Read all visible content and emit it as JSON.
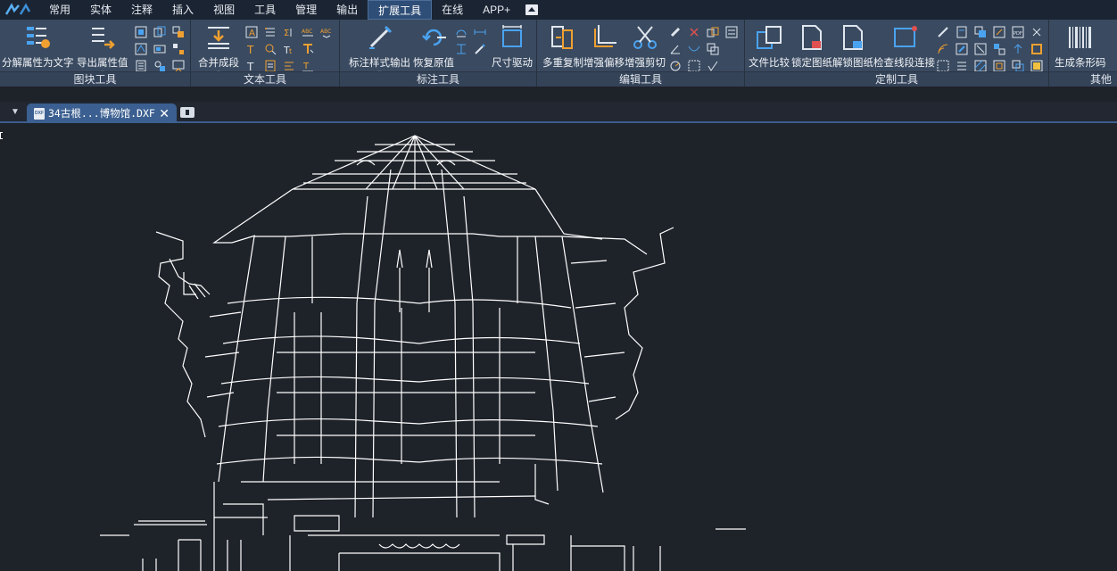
{
  "menu": {
    "items": [
      "常用",
      "实体",
      "注释",
      "插入",
      "视图",
      "工具",
      "管理",
      "输出",
      "扩展工具",
      "在线",
      "APP+"
    ],
    "active_index": 8
  },
  "ribbon": {
    "groups": {
      "block_tools": {
        "label": "图块工具",
        "explode_to_text": "分解属性为文字",
        "export_attr": "导出属性值"
      },
      "text_tools": {
        "label": "文本工具",
        "merge_paragraph": "合并成段"
      },
      "dim_tools": {
        "label": "标注工具",
        "dimstyle_export": "标注样式输出",
        "restore_value": "恢复原值",
        "dim_drive": "尺寸驱动"
      },
      "edit_tools": {
        "label": "编辑工具",
        "multi_copy": "多重复制",
        "enhanced_offset": "增强偏移",
        "enhanced_trim": "增强剪切"
      },
      "custom_tools": {
        "label": "定制工具",
        "file_compare": "文件比较",
        "lock_drawing": "锁定图纸",
        "unlock_drawing": "解锁图纸",
        "check_segments": "检查线段连接"
      },
      "other": {
        "label": "其他",
        "barcode": "生成条形码",
        "more": "生"
      }
    }
  },
  "tabs": {
    "document_name": "34古根...博物馆.DXF",
    "file_icon_text": "DXF"
  },
  "colors": {
    "menubar_bg": "#1b2433",
    "ribbon_bg": "#3a4a60",
    "active_tab": "#3b5f90",
    "canvas_bg": "#1e2229",
    "drawing_lines": "#ffffff",
    "icon_blue": "#4aa3f0",
    "icon_orange": "#f0a030"
  }
}
